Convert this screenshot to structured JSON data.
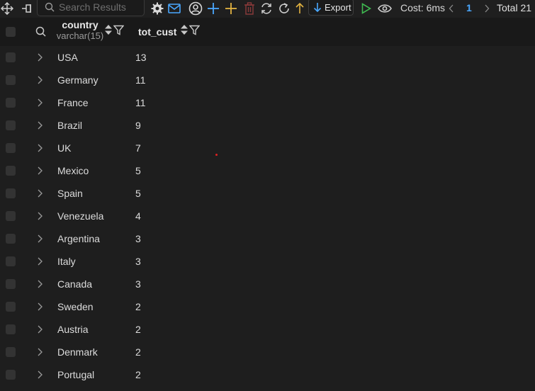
{
  "toolbar": {
    "search_placeholder": "Search Results",
    "export_label": "Export",
    "cost_text": "Cost: 6ms",
    "page_number": "1",
    "total_text": "Total 21",
    "icons": [
      "move-icon",
      "pin-icon",
      "search-icon",
      "settings-icon",
      "mail-icon",
      "user-icon",
      "add-row-icon",
      "add-column-icon",
      "delete-icon",
      "sync-icon",
      "refresh-icon",
      "upload-icon",
      "export-down-arrow-icon",
      "run-icon",
      "view-icon",
      "prev-page-icon",
      "next-page-icon"
    ]
  },
  "table": {
    "columns": [
      {
        "name": "country",
        "type": "varchar(15)"
      },
      {
        "name": "tot_cust",
        "type": ""
      }
    ],
    "rows": [
      {
        "country": "USA",
        "tot_cust": "13"
      },
      {
        "country": "Germany",
        "tot_cust": "11"
      },
      {
        "country": "France",
        "tot_cust": "11"
      },
      {
        "country": "Brazil",
        "tot_cust": "9"
      },
      {
        "country": "UK",
        "tot_cust": "7"
      },
      {
        "country": "Mexico",
        "tot_cust": "5"
      },
      {
        "country": "Spain",
        "tot_cust": "5"
      },
      {
        "country": "Venezuela",
        "tot_cust": "4"
      },
      {
        "country": "Argentina",
        "tot_cust": "3"
      },
      {
        "country": "Italy",
        "tot_cust": "3"
      },
      {
        "country": "Canada",
        "tot_cust": "3"
      },
      {
        "country": "Sweden",
        "tot_cust": "2"
      },
      {
        "country": "Austria",
        "tot_cust": "2"
      },
      {
        "country": "Denmark",
        "tot_cust": "2"
      },
      {
        "country": "Portugal",
        "tot_cust": "2"
      }
    ]
  },
  "colors": {
    "background": "#1e1e1e",
    "accent_blue": "#4aa8ff",
    "run_green": "#3fb950",
    "add_yellow": "#e3b341",
    "delete_red": "#c0392b"
  }
}
